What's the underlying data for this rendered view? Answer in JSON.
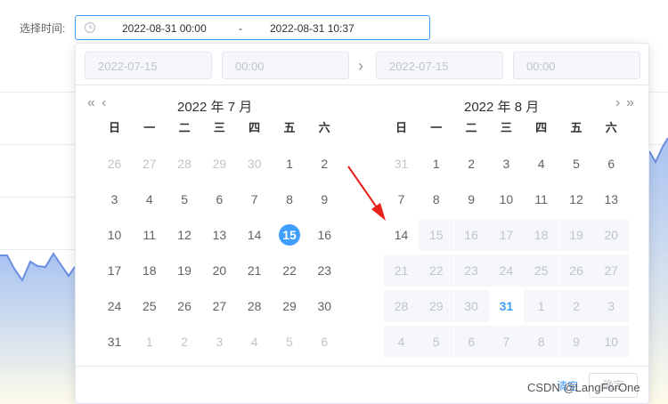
{
  "form": {
    "label": "选择时间:",
    "clock_icon": "clock-icon",
    "range_start": "2022-08-31 00:00",
    "range_separator": "-",
    "range_end": "2022-08-31 10:37"
  },
  "picker": {
    "start_date_placeholder": "2022-07-15",
    "start_time_placeholder": "00:00",
    "end_date_placeholder": "2022-07-15",
    "end_time_placeholder": "00:00",
    "arrow_icon": "chevron-right-icon",
    "left": {
      "title": "2022 年 7 月",
      "prev_year": "«",
      "prev_month": "‹",
      "weekdays": [
        "日",
        "一",
        "二",
        "三",
        "四",
        "五",
        "六"
      ],
      "rows": [
        [
          {
            "d": "26",
            "s": "other"
          },
          {
            "d": "27",
            "s": "other"
          },
          {
            "d": "28",
            "s": "other"
          },
          {
            "d": "29",
            "s": "other"
          },
          {
            "d": "30",
            "s": "other"
          },
          {
            "d": "1",
            "s": ""
          },
          {
            "d": "2",
            "s": ""
          }
        ],
        [
          {
            "d": "3",
            "s": ""
          },
          {
            "d": "4",
            "s": ""
          },
          {
            "d": "5",
            "s": ""
          },
          {
            "d": "6",
            "s": ""
          },
          {
            "d": "7",
            "s": ""
          },
          {
            "d": "8",
            "s": ""
          },
          {
            "d": "9",
            "s": ""
          }
        ],
        [
          {
            "d": "10",
            "s": ""
          },
          {
            "d": "11",
            "s": ""
          },
          {
            "d": "12",
            "s": ""
          },
          {
            "d": "13",
            "s": ""
          },
          {
            "d": "14",
            "s": ""
          },
          {
            "d": "15",
            "s": "selected"
          },
          {
            "d": "16",
            "s": ""
          }
        ],
        [
          {
            "d": "17",
            "s": ""
          },
          {
            "d": "18",
            "s": ""
          },
          {
            "d": "19",
            "s": ""
          },
          {
            "d": "20",
            "s": ""
          },
          {
            "d": "21",
            "s": ""
          },
          {
            "d": "22",
            "s": ""
          },
          {
            "d": "23",
            "s": ""
          }
        ],
        [
          {
            "d": "24",
            "s": ""
          },
          {
            "d": "25",
            "s": ""
          },
          {
            "d": "26",
            "s": ""
          },
          {
            "d": "27",
            "s": ""
          },
          {
            "d": "28",
            "s": ""
          },
          {
            "d": "29",
            "s": ""
          },
          {
            "d": "30",
            "s": ""
          }
        ],
        [
          {
            "d": "31",
            "s": ""
          },
          {
            "d": "1",
            "s": "other"
          },
          {
            "d": "2",
            "s": "other"
          },
          {
            "d": "3",
            "s": "other"
          },
          {
            "d": "4",
            "s": "other"
          },
          {
            "d": "5",
            "s": "other"
          },
          {
            "d": "6",
            "s": "other"
          }
        ]
      ]
    },
    "right": {
      "title": "2022 年 8 月",
      "next_month": "›",
      "next_year": "»",
      "weekdays": [
        "日",
        "一",
        "二",
        "三",
        "四",
        "五",
        "六"
      ],
      "rows": [
        [
          {
            "d": "31",
            "s": "other"
          },
          {
            "d": "1",
            "s": ""
          },
          {
            "d": "2",
            "s": ""
          },
          {
            "d": "3",
            "s": ""
          },
          {
            "d": "4",
            "s": ""
          },
          {
            "d": "5",
            "s": ""
          },
          {
            "d": "6",
            "s": ""
          }
        ],
        [
          {
            "d": "7",
            "s": ""
          },
          {
            "d": "8",
            "s": ""
          },
          {
            "d": "9",
            "s": ""
          },
          {
            "d": "10",
            "s": ""
          },
          {
            "d": "11",
            "s": ""
          },
          {
            "d": "12",
            "s": ""
          },
          {
            "d": "13",
            "s": ""
          }
        ],
        [
          {
            "d": "14",
            "s": ""
          },
          {
            "d": "15",
            "s": "disabled"
          },
          {
            "d": "16",
            "s": "disabled"
          },
          {
            "d": "17",
            "s": "disabled"
          },
          {
            "d": "18",
            "s": "disabled"
          },
          {
            "d": "19",
            "s": "disabled"
          },
          {
            "d": "20",
            "s": "disabled"
          }
        ],
        [
          {
            "d": "21",
            "s": "disabled"
          },
          {
            "d": "22",
            "s": "disabled"
          },
          {
            "d": "23",
            "s": "disabled"
          },
          {
            "d": "24",
            "s": "disabled"
          },
          {
            "d": "25",
            "s": "disabled"
          },
          {
            "d": "26",
            "s": "disabled"
          },
          {
            "d": "27",
            "s": "disabled"
          }
        ],
        [
          {
            "d": "28",
            "s": "disabled"
          },
          {
            "d": "29",
            "s": "disabled"
          },
          {
            "d": "30",
            "s": "disabled"
          },
          {
            "d": "31",
            "s": "today"
          },
          {
            "d": "1",
            "s": "disabled"
          },
          {
            "d": "2",
            "s": "disabled"
          },
          {
            "d": "3",
            "s": "disabled"
          }
        ],
        [
          {
            "d": "4",
            "s": "disabled"
          },
          {
            "d": "5",
            "s": "disabled"
          },
          {
            "d": "6",
            "s": "disabled"
          },
          {
            "d": "7",
            "s": "disabled"
          },
          {
            "d": "8",
            "s": "disabled"
          },
          {
            "d": "9",
            "s": "disabled"
          },
          {
            "d": "10",
            "s": "disabled"
          }
        ]
      ]
    },
    "footer": {
      "clear_label": "清空",
      "ok_label": "确定"
    }
  },
  "watermark": "CSDN @LangForOne",
  "colors": {
    "accent": "#409eff",
    "annotation_arrow": "#e8221b"
  }
}
